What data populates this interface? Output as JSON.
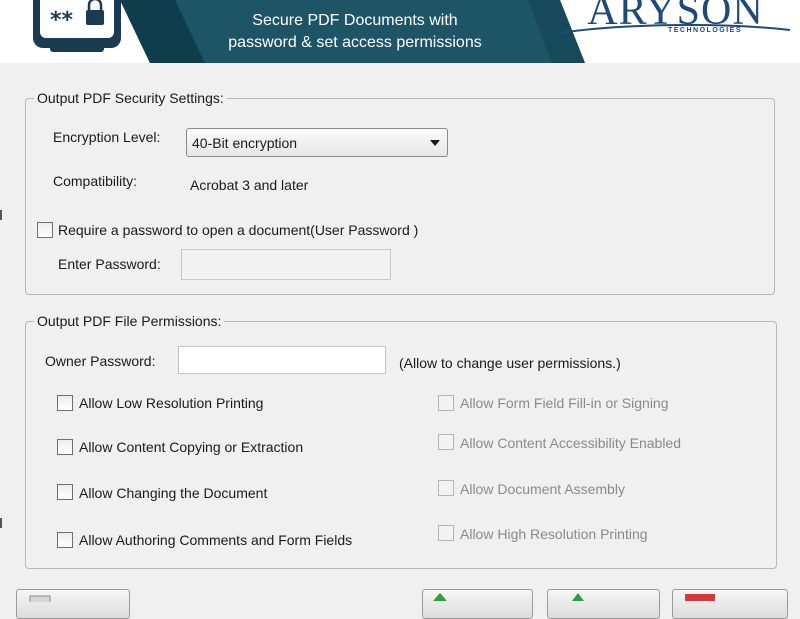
{
  "banner": {
    "tagline_line1": "Secure PDF Documents with",
    "tagline_line2": "password & set access permissions",
    "brand_name": "ARYSON",
    "brand_sub": "TECHNOLOGIES",
    "icon": "password-lock-icon",
    "colors": {
      "band": "#1e5566",
      "accent": "#0f3d4c",
      "icon_outline": "#1b3b52"
    }
  },
  "security_settings": {
    "legend": "Output PDF Security Settings:",
    "encryption_label": "Encryption Level:",
    "encryption_value": "40-Bit encryption",
    "compatibility_label": "Compatibility:",
    "compatibility_value": "Acrobat 3 and later",
    "require_password_label": "Require a password to open a document(User Password )",
    "require_password_checked": false,
    "enter_password_label": "Enter Password:",
    "enter_password_value": ""
  },
  "permissions": {
    "legend": "Output PDF File Permissions:",
    "owner_password_label": "Owner Password:",
    "owner_password_value": "",
    "owner_password_hint": "(Allow to change user permissions.)",
    "left_options": [
      {
        "label": "Allow Low Resolution Printing",
        "checked": false,
        "enabled": true
      },
      {
        "label": "Allow Content Copying or Extraction",
        "checked": false,
        "enabled": true
      },
      {
        "label": "Allow Changing the Document",
        "checked": false,
        "enabled": true
      },
      {
        "label": "Allow Authoring Comments and Form Fields",
        "checked": false,
        "enabled": true
      }
    ],
    "right_options": [
      {
        "label": "Allow Form Field Fill-in or Signing",
        "checked": false,
        "enabled": false
      },
      {
        "label": "Allow Content Accessibility Enabled",
        "checked": false,
        "enabled": false
      },
      {
        "label": "Allow Document Assembly",
        "checked": false,
        "enabled": false
      },
      {
        "label": "Allow High Resolution Printing",
        "checked": false,
        "enabled": false
      }
    ]
  },
  "footer_buttons": [
    {
      "icon": "save-icon"
    },
    {
      "icon": "back-arrow-icon"
    },
    {
      "icon": "next-arrow-icon"
    },
    {
      "icon": "cancel-icon"
    }
  ]
}
